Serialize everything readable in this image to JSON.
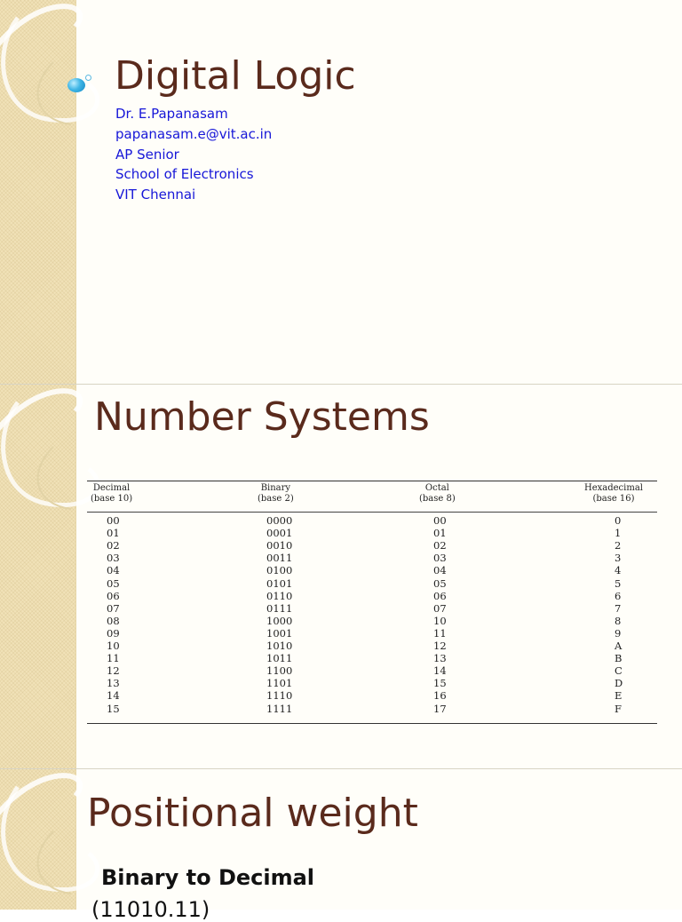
{
  "slides": [
    {
      "title": "Digital Logic",
      "author_lines": [
        "Dr. E.Papanasam",
        "papanasam.e@vit.ac.in",
        "AP Senior",
        "School of Electronics",
        "VIT Chennai"
      ]
    },
    {
      "title": "Number Systems",
      "table": {
        "headers": [
          {
            "name": "Decimal",
            "base": "(base 10)"
          },
          {
            "name": "Binary",
            "base": "(base 2)"
          },
          {
            "name": "Octal",
            "base": "(base 8)"
          },
          {
            "name": "Hexadecimal",
            "base": "(base 16)"
          }
        ],
        "rows": [
          [
            "00",
            "0000",
            "00",
            "0"
          ],
          [
            "01",
            "0001",
            "01",
            "1"
          ],
          [
            "02",
            "0010",
            "02",
            "2"
          ],
          [
            "03",
            "0011",
            "03",
            "3"
          ],
          [
            "04",
            "0100",
            "04",
            "4"
          ],
          [
            "05",
            "0101",
            "05",
            "5"
          ],
          [
            "06",
            "0110",
            "06",
            "6"
          ],
          [
            "07",
            "0111",
            "07",
            "7"
          ],
          [
            "08",
            "1000",
            "10",
            "8"
          ],
          [
            "09",
            "1001",
            "11",
            "9"
          ],
          [
            "10",
            "1010",
            "12",
            "A"
          ],
          [
            "11",
            "1011",
            "13",
            "B"
          ],
          [
            "12",
            "1100",
            "14",
            "C"
          ],
          [
            "13",
            "1101",
            "15",
            "D"
          ],
          [
            "14",
            "1110",
            "16",
            "E"
          ],
          [
            "15",
            "1111",
            "17",
            "F"
          ]
        ]
      }
    },
    {
      "title": "Positional weight",
      "subheading": "Binary to Decimal",
      "expression": "(11010.11)"
    }
  ],
  "colors": {
    "title": "#5a2a1c",
    "author_text": "#1717d8",
    "strip": "#f1e2b8"
  }
}
